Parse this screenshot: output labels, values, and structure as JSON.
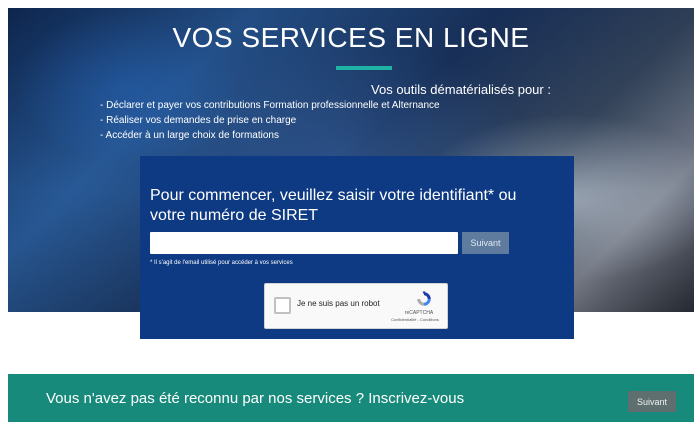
{
  "hero": {
    "title": "VOS SERVICES EN LIGNE",
    "subtitle": "Vos outils dématérialisés pour :",
    "items": [
      "- Déclarer et payer vos contributions Formation professionnelle et Alternance",
      "- Réaliser vos demandes de prise en charge",
      "- Accéder à un large choix de formations"
    ],
    "accent_color": "#1fb3a6"
  },
  "login": {
    "prompt": "Pour commencer, veuillez saisir votre identifiant* ou votre numéro de SIRET",
    "input_value": "",
    "submit_label": "Suivant",
    "note": "* Il s'agit de l'email utilisé pour accéder à vos services",
    "card_color": "#0d3a82"
  },
  "captcha": {
    "label": "Je ne suis pas un robot",
    "brand": "reCAPTCHA",
    "links": "Confidentialité - Conditions",
    "checked": false
  },
  "signup": {
    "text": "Vous n'avez pas été reconnu par nos services ? Inscrivez-vous",
    "button_label": "Suivant",
    "bar_color": "#178a7b"
  }
}
